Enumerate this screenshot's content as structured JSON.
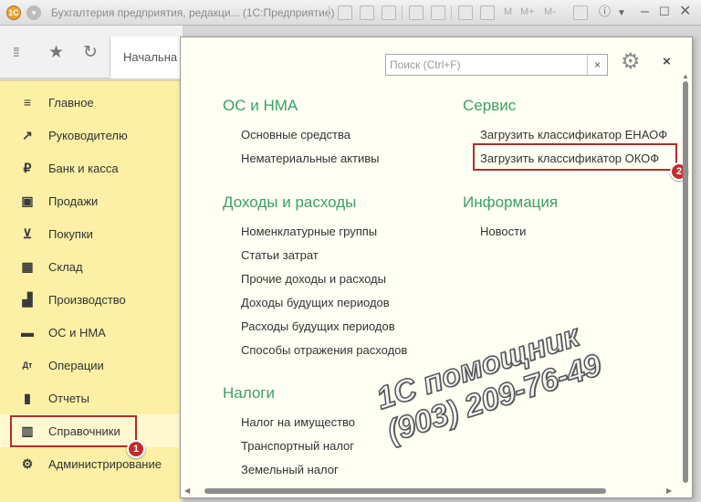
{
  "window": {
    "title": "Бухгалтерия предприятия, редакци... (1С:Предприятие)",
    "toolbar_text": [
      "M",
      "M+",
      "M-"
    ]
  },
  "toolbar": {
    "home_tab": "Начальна"
  },
  "sidebar": {
    "items": [
      {
        "label": "Главное",
        "icon": "menu-lines-icon"
      },
      {
        "label": "Руководителю",
        "icon": "trend-icon"
      },
      {
        "label": "Банк и касса",
        "icon": "ruble-coin-icon"
      },
      {
        "label": "Продажи",
        "icon": "shopping-bag-icon"
      },
      {
        "label": "Покупки",
        "icon": "cart-icon"
      },
      {
        "label": "Склад",
        "icon": "warehouse-grid-icon"
      },
      {
        "label": "Производство",
        "icon": "factory-icon"
      },
      {
        "label": "ОС и НМА",
        "icon": "truck-icon"
      },
      {
        "label": "Операции",
        "icon": "debit-credit-icon"
      },
      {
        "label": "Отчеты",
        "icon": "bar-chart-icon"
      },
      {
        "label": "Справочники",
        "icon": "books-icon"
      },
      {
        "label": "Администрирование",
        "icon": "gear-icon"
      }
    ]
  },
  "panel": {
    "search_placeholder": "Поиск (Ctrl+F)",
    "search_clear": "×",
    "close": "×",
    "sections": {
      "os": {
        "title": "ОС и НМА",
        "links": [
          "Основные средства",
          "Нематериальные активы"
        ]
      },
      "income": {
        "title": "Доходы и расходы",
        "links": [
          "Номенклатурные группы",
          "Статьи затрат",
          "Прочие доходы и расходы",
          "Доходы будущих периодов",
          "Расходы будущих периодов",
          "Способы отражения расходов"
        ]
      },
      "taxes": {
        "title": "Налоги",
        "links": [
          "Налог на имущество",
          "Транспортный налог",
          "Земельный налог"
        ]
      },
      "service": {
        "title": "Сервис",
        "links": [
          "Загрузить классификатор ЕНАОФ",
          "Загрузить классификатор ОКОФ"
        ]
      },
      "info": {
        "title": "Информация",
        "links": [
          "Новости"
        ]
      }
    }
  },
  "annotations": {
    "marker1": "1",
    "marker2": "2"
  },
  "watermark": {
    "line1": "1С помощник",
    "line2": "(903) 209-76-49"
  },
  "colors": {
    "sidebar_bg": "#fbf0a5",
    "section_title": "#3aa064",
    "highlight": "#b42b2b",
    "panel_bg": "#fffff3"
  }
}
